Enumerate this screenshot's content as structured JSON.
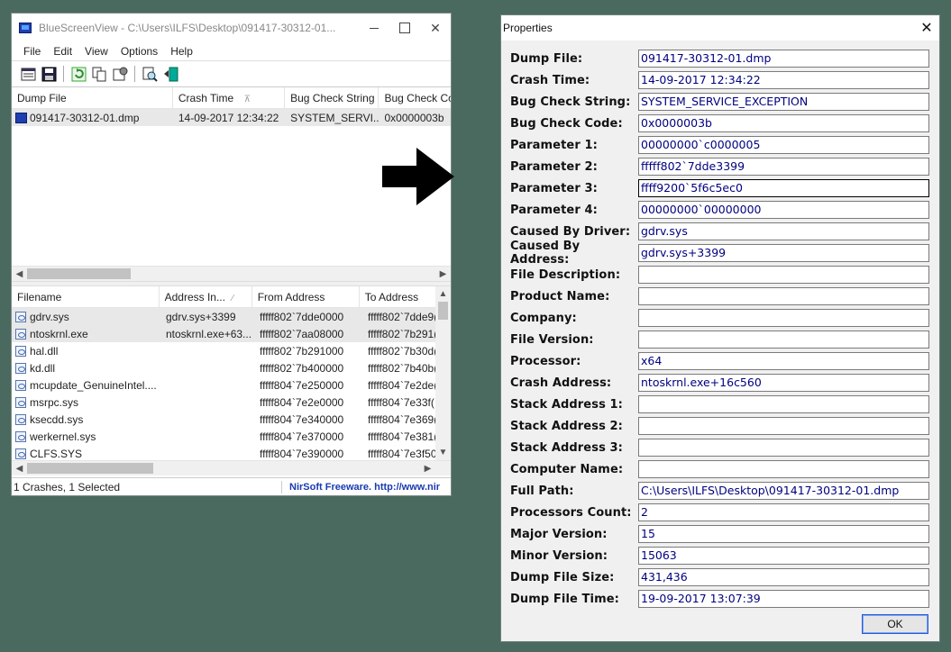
{
  "main_window": {
    "title": "BlueScreenView  -  C:\\Users\\ILFS\\Desktop\\091417-30312-01...",
    "close_glyph": "✕",
    "menu": [
      "File",
      "Edit",
      "View",
      "Options",
      "Help"
    ],
    "toolbar_icons": [
      "properties-icon",
      "save-icon",
      "refresh-icon",
      "copy-icon",
      "options-icon",
      "find-icon",
      "exit-icon"
    ],
    "upper_list": {
      "columns": [
        "Dump File",
        "Crash Time",
        "Bug Check String",
        "Bug Check Co"
      ],
      "sort_glyph": "⊼",
      "rows": [
        {
          "dump_file": "091417-30312-01.dmp",
          "crash_time": "14-09-2017 12:34:22",
          "bug_check_string": "SYSTEM_SERVI...",
          "bug_check_code": "0x0000003b"
        }
      ]
    },
    "lower_list": {
      "columns": [
        "Filename",
        "Address In...",
        "From Address",
        "To Address"
      ],
      "sort_glyph": "⁄",
      "rows": [
        {
          "filename": "gdrv.sys",
          "address_in": "gdrv.sys+3399",
          "from": "fffff802`7dde0000",
          "to": "fffff802`7dde9("
        },
        {
          "filename": "ntoskrnl.exe",
          "address_in": "ntoskrnl.exe+63...",
          "from": "fffff802`7aa08000",
          "to": "fffff802`7b291("
        },
        {
          "filename": "hal.dll",
          "address_in": "",
          "from": "fffff802`7b291000",
          "to": "fffff802`7b30d("
        },
        {
          "filename": "kd.dll",
          "address_in": "",
          "from": "fffff802`7b400000",
          "to": "fffff802`7b40b("
        },
        {
          "filename": "mcupdate_GenuineIntel....",
          "address_in": "",
          "from": "fffff804`7e250000",
          "to": "fffff804`7e2de("
        },
        {
          "filename": "msrpc.sys",
          "address_in": "",
          "from": "fffff804`7e2e0000",
          "to": "fffff804`7e33f("
        },
        {
          "filename": "ksecdd.sys",
          "address_in": "",
          "from": "fffff804`7e340000",
          "to": "fffff804`7e369("
        },
        {
          "filename": "werkernel.sys",
          "address_in": "",
          "from": "fffff804`7e370000",
          "to": "fffff804`7e381("
        },
        {
          "filename": "CLFS.SYS",
          "address_in": "",
          "from": "fffff804`7e390000",
          "to": "fffff804`7e3f50"
        }
      ]
    },
    "status": {
      "left": "1 Crashes, 1 Selected",
      "right": "NirSoft Freeware.  http://www.nir"
    }
  },
  "properties": {
    "title": "Properties",
    "close_glyph": "✕",
    "ok_label": "OK",
    "rows": [
      {
        "label": "Dump File:",
        "value": "091417-30312-01.dmp"
      },
      {
        "label": "Crash Time:",
        "value": "14-09-2017 12:34:22"
      },
      {
        "label": "Bug Check String:",
        "value": "SYSTEM_SERVICE_EXCEPTION"
      },
      {
        "label": "Bug Check Code:",
        "value": "0x0000003b"
      },
      {
        "label": "Parameter 1:",
        "value": "00000000`c0000005"
      },
      {
        "label": "Parameter 2:",
        "value": "fffff802`7dde3399"
      },
      {
        "label": "Parameter 3:",
        "value": "ffff9200`5f6c5ec0"
      },
      {
        "label": "Parameter 4:",
        "value": "00000000`00000000"
      },
      {
        "label": "Caused By Driver:",
        "value": "gdrv.sys"
      },
      {
        "label": "Caused By Address:",
        "value": "gdrv.sys+3399"
      },
      {
        "label": "File Description:",
        "value": ""
      },
      {
        "label": "Product Name:",
        "value": ""
      },
      {
        "label": "Company:",
        "value": ""
      },
      {
        "label": "File Version:",
        "value": ""
      },
      {
        "label": "Processor:",
        "value": "x64"
      },
      {
        "label": "Crash Address:",
        "value": "ntoskrnl.exe+16c560"
      },
      {
        "label": "Stack Address 1:",
        "value": ""
      },
      {
        "label": "Stack Address 2:",
        "value": ""
      },
      {
        "label": "Stack Address 3:",
        "value": ""
      },
      {
        "label": "Computer Name:",
        "value": ""
      },
      {
        "label": "Full Path:",
        "value": "C:\\Users\\ILFS\\Desktop\\091417-30312-01.dmp"
      },
      {
        "label": "Processors Count:",
        "value": "2"
      },
      {
        "label": "Major Version:",
        "value": "15"
      },
      {
        "label": "Minor Version:",
        "value": "15063"
      },
      {
        "label": "Dump File Size:",
        "value": "431,436"
      },
      {
        "label": "Dump File Time:",
        "value": "19-09-2017 13:07:39"
      }
    ]
  },
  "colors": {
    "background": "#4a6a60",
    "value_text": "#000080",
    "link_text": "#1a3ab0"
  }
}
